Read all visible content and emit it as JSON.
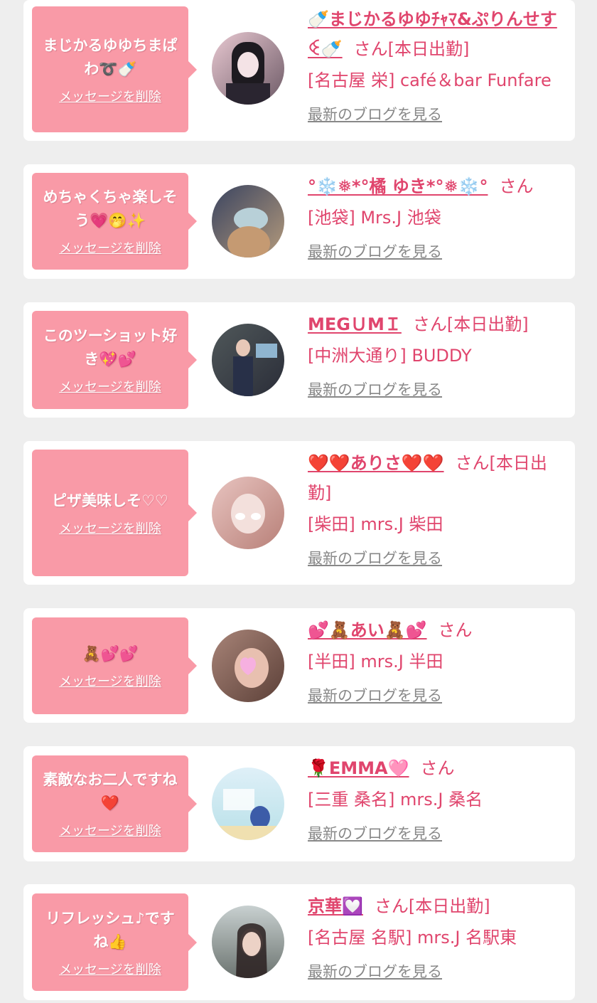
{
  "ui": {
    "delete_label": "メッセージを削除",
    "blog_label": "最新のブログを見る"
  },
  "colors": {
    "page_bg": "#eeeeee",
    "card_bg": "#ffffff",
    "bubble_bg": "#f99aa7",
    "name_color": "#e0456d",
    "link_gray": "#888888"
  },
  "items": [
    {
      "message": "まじかるゆゆちまぱわ➰🍼",
      "name": "🍼まじかるゆゆﾁｬﾏ&ぷりんせすꒊ🍼",
      "suffix": "さん[本日出勤]",
      "shop": "[名古屋 栄] café＆bar Funfare",
      "avatar": "avatar-photo"
    },
    {
      "message": "めちゃくちゃ楽しそう💗🤭✨",
      "name": "°❄️❅*°橘 ゆき*°❅❄️°",
      "suffix": "さん",
      "shop": "[池袋] Mrs.J 池袋",
      "avatar": "avatar-photo"
    },
    {
      "message": "このツーショット好き💖💕",
      "name": "MEGＵMＩ",
      "suffix": "さん[本日出勤]",
      "shop": "[中洲大通り] BUDDY",
      "avatar": "avatar-photo"
    },
    {
      "message": "ピザ美味しそ♡♡",
      "name": "❤️❤️ありさ❤️❤️",
      "suffix": "さん[本日出勤]",
      "shop": "[柴田] mrs.J 柴田",
      "avatar": "avatar-photo"
    },
    {
      "message": "🧸💕💕",
      "name": "💕🧸あい🧸💕",
      "suffix": "さん",
      "shop": "[半田] mrs.J 半田",
      "avatar": "avatar-photo"
    },
    {
      "message": "素敵なお二人ですね❤️",
      "name": "🌹EMMA🩷",
      "suffix": "さん",
      "shop": "[三重 桑名] mrs.J 桑名",
      "avatar": "avatar-photo"
    },
    {
      "message": "リフレッシュ♪ですね👍",
      "name": "京華💟",
      "suffix": "さん[本日出勤]",
      "shop": "[名古屋 名駅] mrs.J 名駅東",
      "avatar": "avatar-photo"
    }
  ]
}
